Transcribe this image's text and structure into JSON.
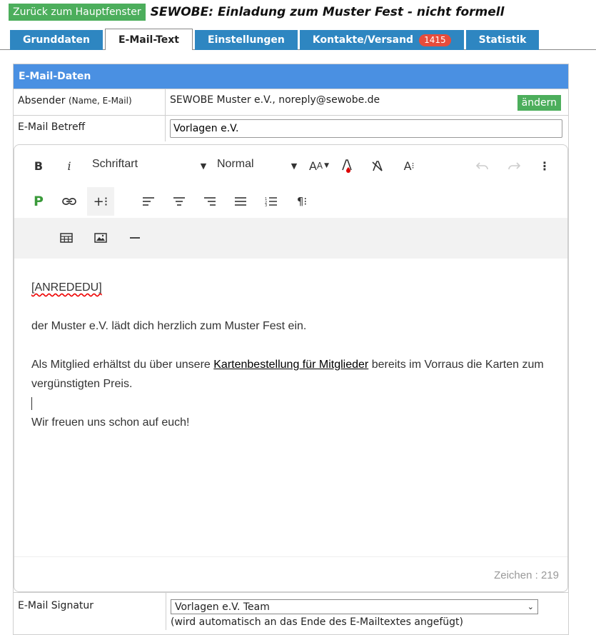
{
  "header": {
    "back_label": "Zurück zum Hauptfenster",
    "title": "SEWOBE: Einladung zum Muster Fest - nicht formell"
  },
  "tabs": [
    {
      "label": "Grunddaten",
      "active": false
    },
    {
      "label": "E-Mail-Text",
      "active": true
    },
    {
      "label": "Einstellungen",
      "active": false
    },
    {
      "label": "Kontakte/Versand",
      "active": false,
      "badge": "1415"
    },
    {
      "label": "Statistik",
      "active": false
    }
  ],
  "panel": {
    "title": "E-Mail-Daten",
    "sender_label": "Absender",
    "sender_label_small": "(Name, E-Mail)",
    "sender_value": "SEWOBE Muster e.V., noreply@sewobe.de",
    "change_label": "ändern",
    "subject_label": "E-Mail Betreff",
    "subject_value": "Vorlagen e.V."
  },
  "editor": {
    "font_select": "Schriftart",
    "size_select": "Normal",
    "counter_label": "Zeichen : 219",
    "content": {
      "line1": "[ANREDEDU]",
      "line2_a": "der Muster e.V. lädt dich herzlich zum Muster Fest ein.",
      "line3_a": "Als Mitglied erhältst du über unsere ",
      "line3_link": "Kartenbestellung für Mitglieder",
      "line3_b": " bereits im Vorraus die Karten zum vergünstigten Preis.",
      "line4": "Wir freuen uns schon auf euch!"
    }
  },
  "signature": {
    "label": "E-Mail Signatur",
    "value": "Vorlagen e.V. Team",
    "hint": "(wird automatisch an das Ende des E-Mailtextes angefügt)"
  },
  "colors": {
    "tab_blue": "#2e86c1",
    "panel_head": "#4a90e2",
    "green_button": "#4cae5c",
    "badge_red": "#e74c3c"
  }
}
